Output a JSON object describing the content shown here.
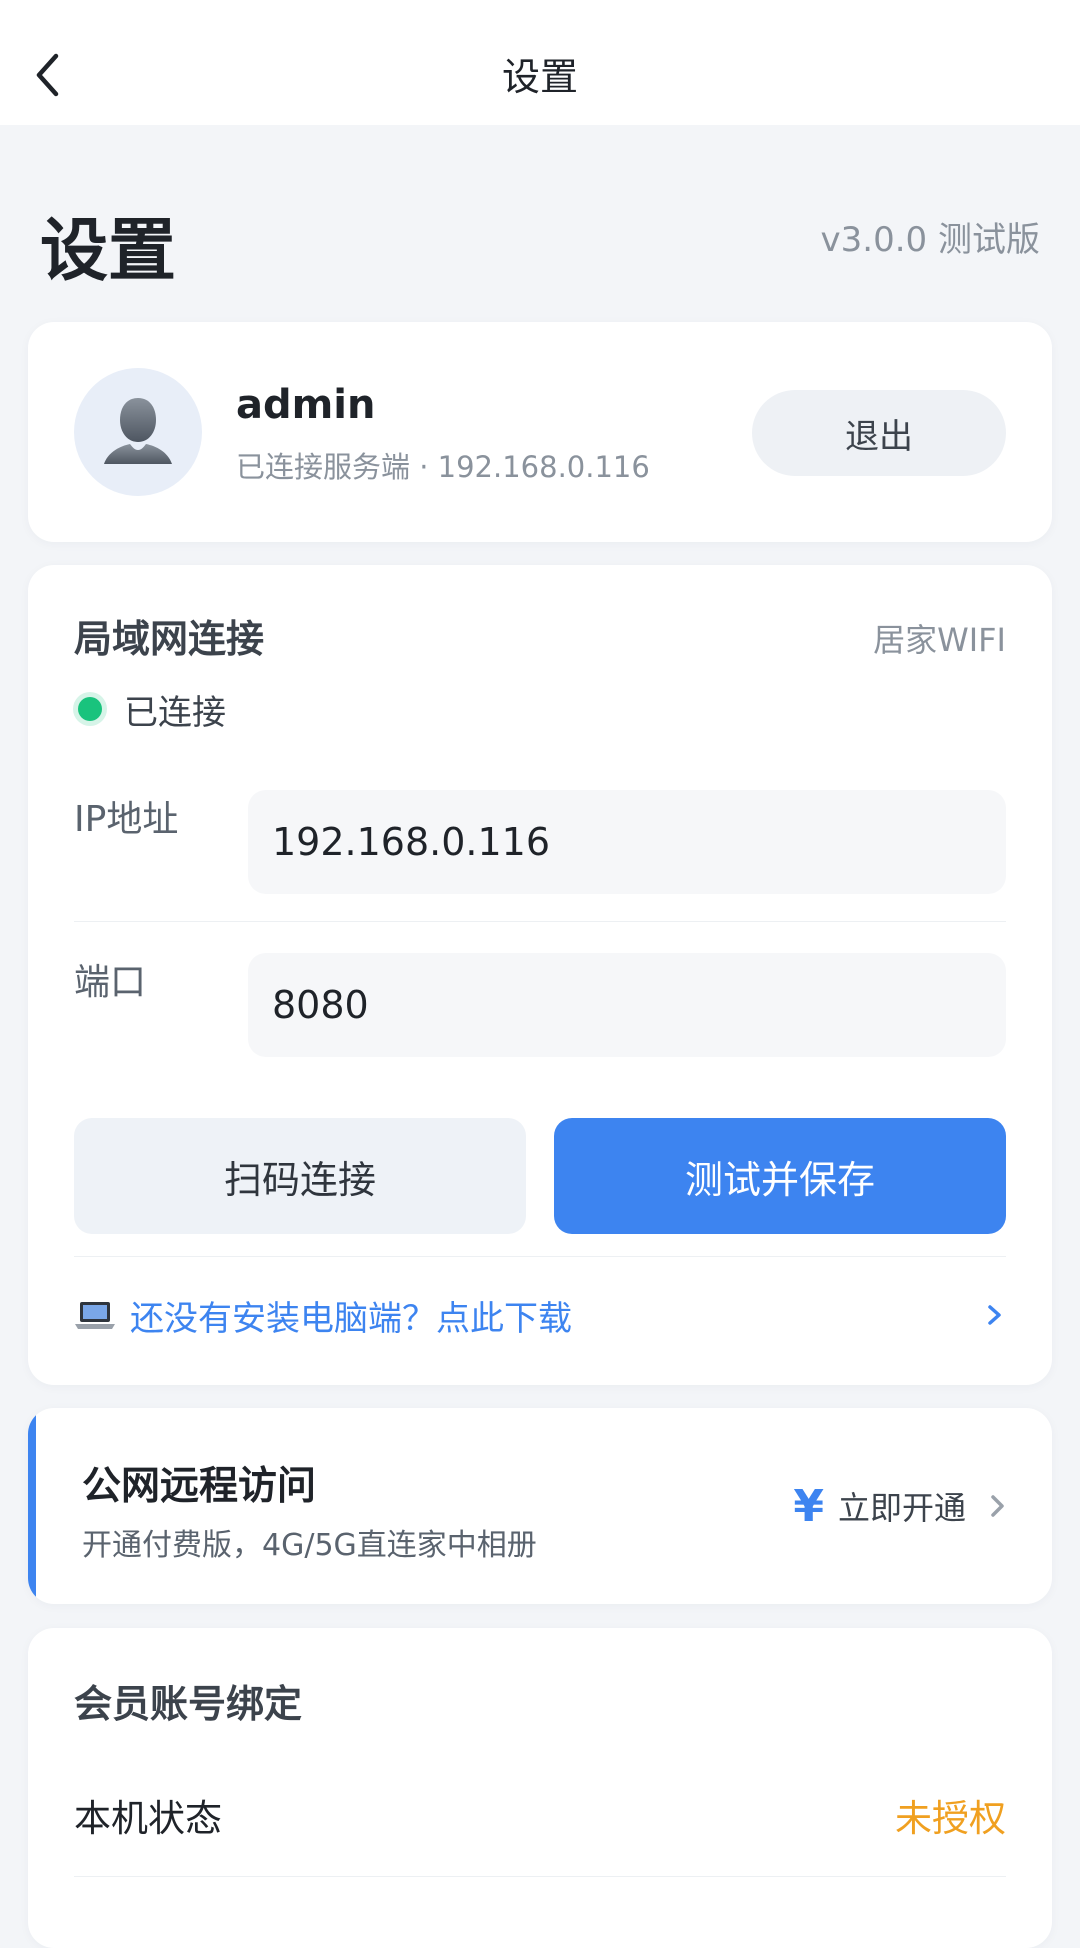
{
  "nav": {
    "title": "设置"
  },
  "header": {
    "title": "设置",
    "version": "v3.0.0 测试版"
  },
  "profile": {
    "username": "admin",
    "status": "已连接服务端 · 192.168.0.116",
    "logout_label": "退出"
  },
  "lan": {
    "title": "局域网连接",
    "network_name": "居家WIFI",
    "status_text": "已连接",
    "ip_label": "IP地址",
    "ip_value": "192.168.0.116",
    "port_label": "端口",
    "port_value": "8080",
    "scan_label": "扫码连接",
    "save_label": "测试并保存",
    "download_text": "还没有安装电脑端？点此下载"
  },
  "remote": {
    "title": "公网远程访问",
    "subtitle": "开通付费版，4G/5G直连家中相册",
    "action_icon": "¥",
    "action_label": "立即开通"
  },
  "member": {
    "title": "会员账号绑定",
    "device_label": "本机状态",
    "device_value": "未授权"
  },
  "colors": {
    "accent": "#3d84f0",
    "connected": "#19c37d",
    "warning": "#f0a020",
    "background": "#f3f5f8"
  },
  "icons": {
    "back": "chevron-left-icon",
    "avatar": "user-icon",
    "laptop": "laptop-icon",
    "chevron": "chevron-right-icon"
  }
}
